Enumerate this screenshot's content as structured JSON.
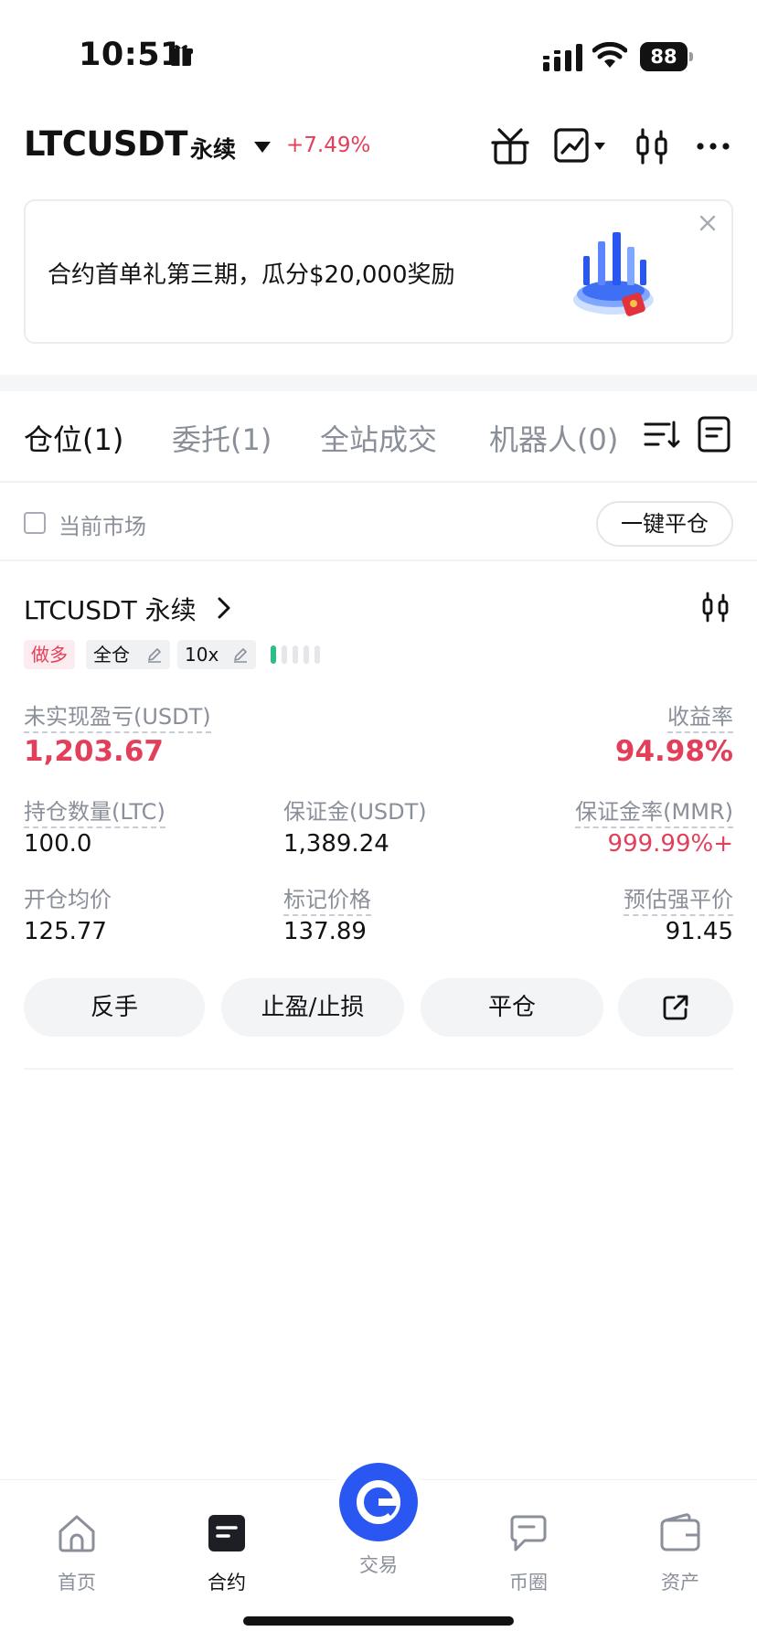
{
  "status_bar": {
    "time": "10:51",
    "battery": "88"
  },
  "header": {
    "symbol": "LTCUSDT",
    "contract_type": "永续",
    "change": "+7.49%"
  },
  "banner": {
    "text": "合约首单礼第三期，瓜分$20,000奖励"
  },
  "tabs": [
    {
      "label": "仓位(1)",
      "active": true
    },
    {
      "label": "委托(1)",
      "active": false
    },
    {
      "label": "全站成交",
      "active": false
    },
    {
      "label": "机器人(0)",
      "active": false
    }
  ],
  "filter": {
    "current_market_label": "当前市场",
    "close_all_label": "一键平仓"
  },
  "position": {
    "symbol_label": "LTCUSDT 永续",
    "side": "做多",
    "margin_mode": "全仓",
    "leverage": "10x",
    "unrealized_pnl_label": "未实现盈亏(USDT)",
    "unrealized_pnl": "1,203.67",
    "roe_label": "收益率",
    "roe": "94.98%",
    "size_label": "持仓数量(LTC)",
    "size": "100.0",
    "margin_label": "保证金(USDT)",
    "margin": "1,389.24",
    "mmr_label": "保证金率(MMR)",
    "mmr": "999.99%+",
    "entry_label": "开仓均价",
    "entry": "125.77",
    "mark_label": "标记价格",
    "mark": "137.89",
    "liq_label": "预估强平价",
    "liq": "91.45",
    "actions": {
      "reverse": "反手",
      "tpsl": "止盈/止损",
      "close": "平仓"
    }
  },
  "bottom_nav": [
    {
      "label": "首页",
      "icon": "home-icon"
    },
    {
      "label": "合约",
      "icon": "futures-icon",
      "active": true
    },
    {
      "label": "交易",
      "icon": "trade-icon"
    },
    {
      "label": "币圈",
      "icon": "community-icon"
    },
    {
      "label": "资产",
      "icon": "wallet-icon"
    }
  ],
  "colors": {
    "accent": "#2a57f2",
    "red": "#e23f5b",
    "green": "#2ebd85"
  }
}
